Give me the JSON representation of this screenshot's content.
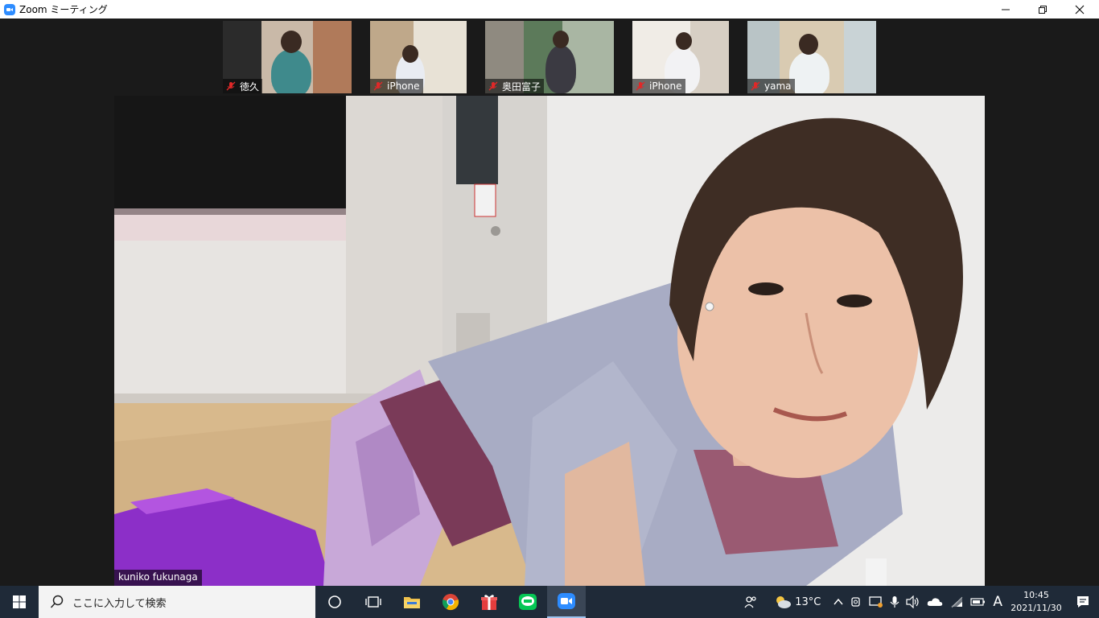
{
  "window": {
    "title": "Zoom ミーティング"
  },
  "participants": [
    {
      "name": "徳久",
      "muted": true
    },
    {
      "name": "iPhone",
      "muted": true
    },
    {
      "name": "奥田富子",
      "muted": true
    },
    {
      "name": "iPhone",
      "muted": true
    },
    {
      "name": "yama",
      "muted": true
    }
  ],
  "speaker": {
    "name": "kuniko fukunaga"
  },
  "taskbar": {
    "search_placeholder": "ここに入力して検索",
    "weather": "13°C",
    "ime": "A",
    "time": "10:45",
    "date": "2021/11/30"
  },
  "colors": {
    "zoom_blue": "#2d8cff",
    "mute_red": "#e02828",
    "taskbar": "#1f2a38"
  }
}
